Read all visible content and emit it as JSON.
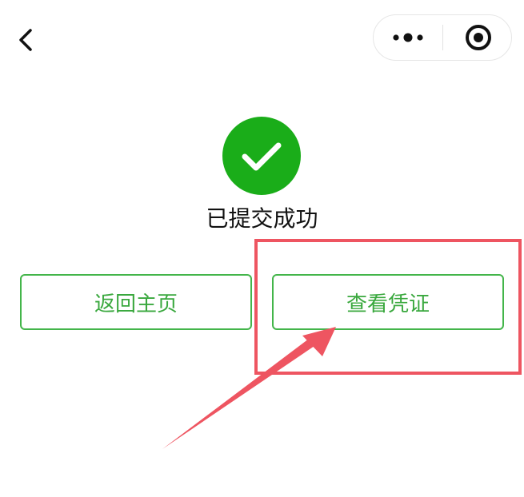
{
  "nav": {
    "back_icon": "chevron-left-icon",
    "capsule": {
      "more_icon": "more-dots-icon",
      "close_icon": "target-circle-icon"
    }
  },
  "result": {
    "icon": "check-circle-icon",
    "status_text": "已提交成功",
    "accent_color": "#1aad19"
  },
  "actions": {
    "home_label": "返回主页",
    "voucher_label": "查看凭证",
    "button_color": "#43b54a"
  },
  "annotation": {
    "highlight_color": "#ee5561",
    "arrow_color": "#ee5561"
  }
}
